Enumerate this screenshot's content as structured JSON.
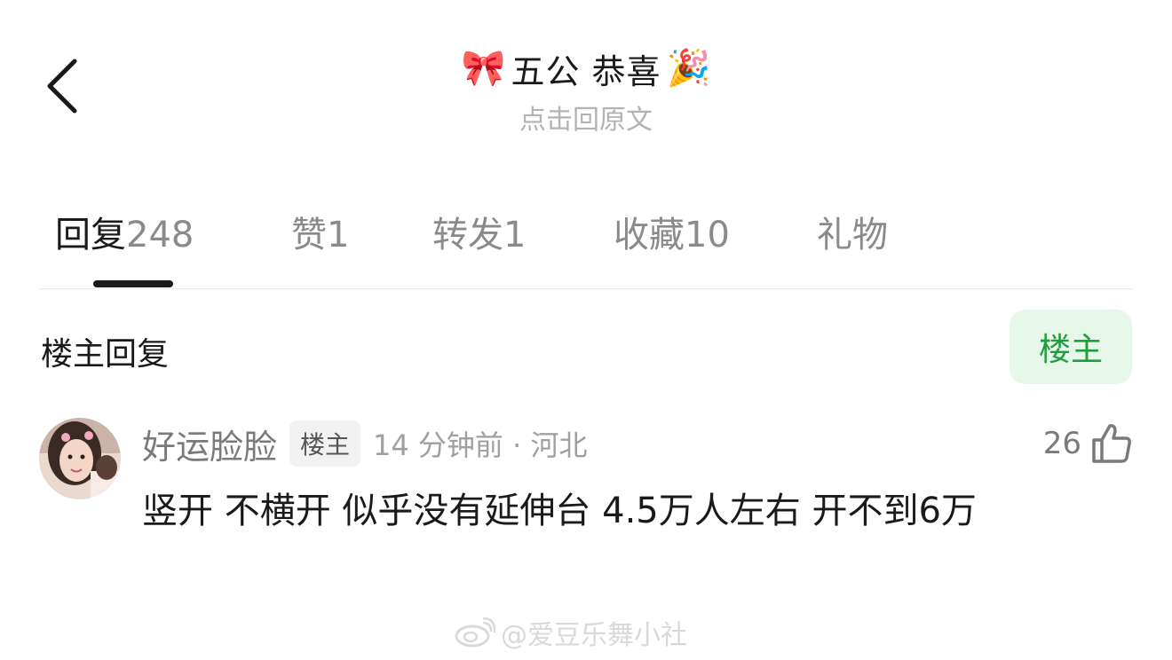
{
  "header": {
    "title": "五公 恭喜",
    "title_prefix_emoji": "🎀",
    "title_suffix_emoji": "🎉",
    "subtitle": "点击回原文",
    "back_icon": "chevron-left-icon"
  },
  "tabs": [
    {
      "label": "回复",
      "count": "248",
      "active": true
    },
    {
      "label": "赞",
      "count": "1",
      "active": false
    },
    {
      "label": "转发",
      "count": "1",
      "active": false
    },
    {
      "label": "收藏",
      "count": "10",
      "active": false
    },
    {
      "label": "礼物",
      "count": "",
      "active": false
    }
  ],
  "section": {
    "title": "楼主回复",
    "filter_label": "楼主"
  },
  "comment": {
    "username": "好运脸脸",
    "badge": "楼主",
    "time_location": "14 分钟前 · 河北",
    "like_count": "26",
    "text": "竖开 不横开 似乎没有延伸台 4.5万人左右 开不到6万"
  },
  "watermark": {
    "text": "@爱豆乐舞小社"
  },
  "colors": {
    "accent_green": "#1f9e3d",
    "filter_bg": "#e7f7ea",
    "muted_text": "#8a8a8a"
  }
}
